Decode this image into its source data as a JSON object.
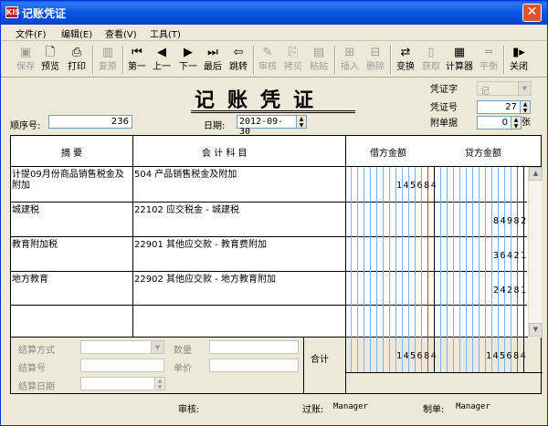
{
  "window": {
    "title": "记账凭证",
    "logo": "KIS"
  },
  "menu": [
    {
      "label": "文件(F)"
    },
    {
      "label": "编辑(E)"
    },
    {
      "label": "查看(V)"
    },
    {
      "label": "工具(T)"
    }
  ],
  "toolbar": [
    {
      "label": "保存",
      "icon": "save-icon",
      "glyph": "💾",
      "enabled": false
    },
    {
      "label": "预览",
      "icon": "preview-icon",
      "glyph": "🔍",
      "enabled": true
    },
    {
      "label": "打印",
      "icon": "print-icon",
      "glyph": "🖶",
      "enabled": true
    },
    {
      "label": "复原",
      "icon": "restore-icon",
      "glyph": "↺",
      "enabled": false
    },
    {
      "label": "第一",
      "icon": "first-icon",
      "glyph": "⏮",
      "enabled": true
    },
    {
      "label": "上一",
      "icon": "prev-icon",
      "glyph": "◀",
      "enabled": true
    },
    {
      "label": "下一",
      "icon": "next-icon",
      "glyph": "▶",
      "enabled": true
    },
    {
      "label": "最后",
      "icon": "last-icon",
      "glyph": "⏭",
      "enabled": true
    },
    {
      "label": "跳转",
      "icon": "jump-icon",
      "glyph": "⇦",
      "enabled": true
    },
    {
      "label": "审核",
      "icon": "audit-icon",
      "glyph": "✎",
      "enabled": false
    },
    {
      "label": "拷贝",
      "icon": "copy-icon",
      "glyph": "⎘",
      "enabled": false
    },
    {
      "label": "粘贴",
      "icon": "paste-icon",
      "glyph": "📋",
      "enabled": false
    },
    {
      "label": "插入",
      "icon": "insert-icon",
      "glyph": "⊞",
      "enabled": false
    },
    {
      "label": "删除",
      "icon": "delete-icon",
      "glyph": "⊟",
      "enabled": false
    },
    {
      "label": "变换",
      "icon": "transform-icon",
      "glyph": "⇄",
      "enabled": true
    },
    {
      "label": "获取",
      "icon": "fetch-icon",
      "glyph": "▤",
      "enabled": false
    },
    {
      "label": "计算器",
      "icon": "calculator-icon",
      "glyph": "▦",
      "enabled": true
    },
    {
      "label": "平衡",
      "icon": "balance-icon",
      "glyph": "=",
      "enabled": false
    },
    {
      "label": "关闭",
      "icon": "close-door-icon",
      "glyph": "▮▸",
      "enabled": true
    }
  ],
  "voucher": {
    "title": "记账凭证",
    "seq_label": "顺序号:",
    "seq_value": "236",
    "date_label": "日期:",
    "date_value": "2012-09-30",
    "word_label": "凭证字",
    "word_value": "记",
    "num_label": "凭证号",
    "num_value": "27",
    "attach_label": "附单据",
    "attach_value": "0",
    "attach_unit": "张"
  },
  "grid": {
    "headers": {
      "summary": "摘    要",
      "account": "会 计 科 目",
      "debit": "借方金额",
      "credit": "贷方金额"
    },
    "rows": [
      {
        "summary": "计提09月份商品销售税金及附加",
        "account": "504 产品销售税金及附加",
        "debit": "145684",
        "credit": ""
      },
      {
        "summary": "城建税",
        "account": "22102 应交税金 - 城建税",
        "debit": "",
        "credit": "84982"
      },
      {
        "summary": "教育附加税",
        "account": "22901 其他应交款 - 教育费附加",
        "debit": "",
        "credit": "36421"
      },
      {
        "summary": "地方教育",
        "account": "22902 其他应交款 - 地方教育附加",
        "debit": "",
        "credit": "24281"
      }
    ],
    "total_label": "合计",
    "total_debit": "145684",
    "total_credit": "145684"
  },
  "settlement": {
    "method_label": "结算方式",
    "number_label": "结算号",
    "date_label": "结算日期",
    "qty_label": "数量",
    "price_label": "单价"
  },
  "footer": {
    "audit_label": "审核:",
    "audit_value": "",
    "post_label": "过账:",
    "post_value": "Manager",
    "maker_label": "制单:",
    "maker_value": "Manager"
  }
}
